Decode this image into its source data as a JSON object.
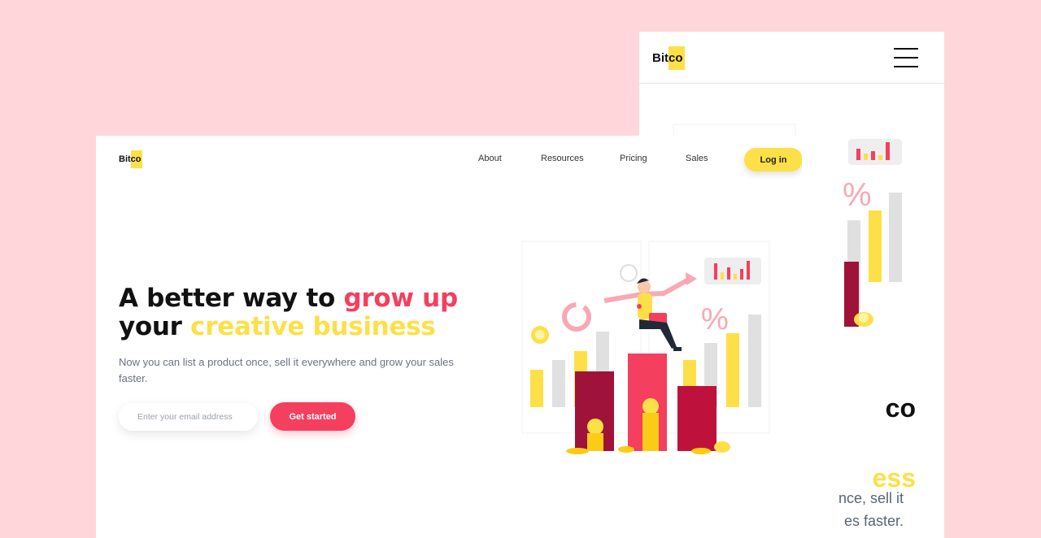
{
  "brand": {
    "prefix": "Bit",
    "highlight": "co"
  },
  "nav": {
    "links": [
      "About",
      "Resources",
      "Pricing",
      "Sales"
    ],
    "login": "Log in"
  },
  "hero": {
    "title_line1_plain": "A better way to ",
    "title_line1_accent": "grow up",
    "title_line2_plain": "your ",
    "title_line2_accent": "creative business",
    "subtitle": "Now you can list a product once, sell it everywhere and grow your sales faster.",
    "email_placeholder": "Enter your email address",
    "cta": "Get started"
  },
  "mobile": {
    "heading_fragment_1": "co",
    "heading_fragment_2": "ess",
    "text_line1": "nce, sell it",
    "text_line2": "es faster."
  },
  "illustration": {
    "percent_symbol": "%"
  },
  "colors": {
    "background": "#FFD7DB",
    "brand_yellow": "#FDE047",
    "accent_pink": "#F43F5E",
    "dark_red": "#9F1239"
  }
}
